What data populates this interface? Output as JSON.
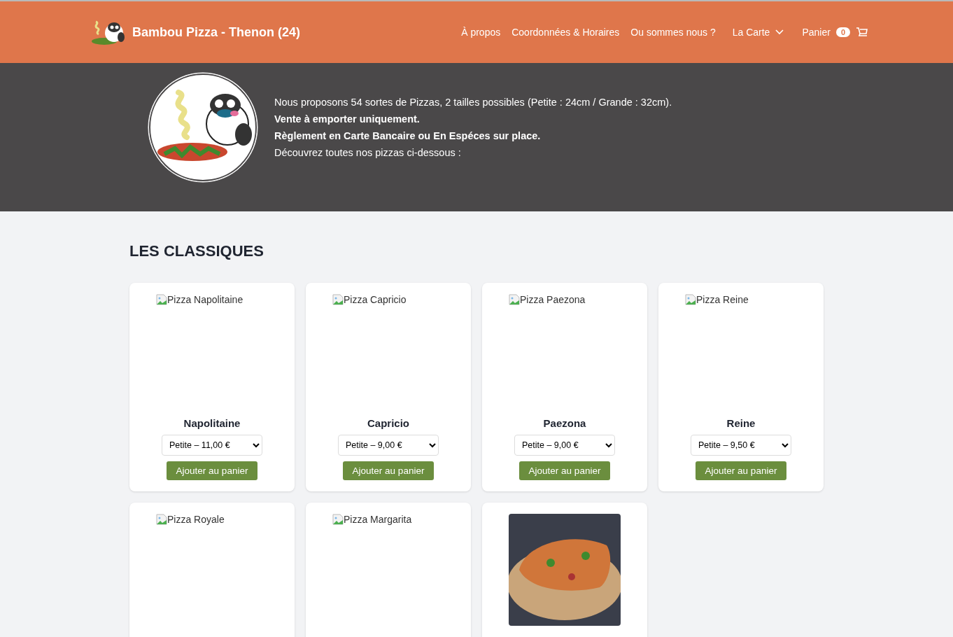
{
  "header": {
    "brand": "Bambou Pizza - Thenon (24)",
    "nav": [
      {
        "label": "À propos",
        "kind": "link"
      },
      {
        "label": "Coordonnées & Horaires",
        "kind": "link"
      },
      {
        "label": "Ou sommes nous ?",
        "kind": "link"
      },
      {
        "label": "La Carte",
        "kind": "dropdown"
      }
    ],
    "cart": {
      "label": "Panier",
      "count": "0"
    }
  },
  "hero": {
    "lines": [
      {
        "text": "Nous proposons 54 sortes de Pizzas, 2 tailles possibles (Petite : 24cm / Grande : 32cm).",
        "bold": false
      },
      {
        "text": "Vente à emporter uniquement.",
        "bold": true
      },
      {
        "text": "Règlement en Carte Bancaire ou En Espéces sur place.",
        "bold": true
      },
      {
        "text": "Découvrez toutes nos pizzas ci-dessous :",
        "bold": false
      }
    ]
  },
  "section": {
    "title": "LES CLASSIQUES",
    "products": [
      {
        "image": {
          "kind": "broken",
          "alt": "Pizza Napolitaine"
        },
        "name": "Napolitaine",
        "option": "Petite – 11,00 €",
        "button": "Ajouter au panier"
      },
      {
        "image": {
          "kind": "broken",
          "alt": "Pizza Capricio"
        },
        "name": "Capricio",
        "option": "Petite – 9,00 €",
        "button": "Ajouter au panier"
      },
      {
        "image": {
          "kind": "broken",
          "alt": "Pizza Paezona"
        },
        "name": "Paezona",
        "option": "Petite – 9,00 €",
        "button": "Ajouter au panier"
      },
      {
        "image": {
          "kind": "broken",
          "alt": "Pizza Reine"
        },
        "name": "Reine",
        "option": "Petite – 9,50 €",
        "button": "Ajouter au panier"
      },
      {
        "image": {
          "kind": "broken",
          "alt": "Pizza Royale"
        }
      },
      {
        "image": {
          "kind": "broken",
          "alt": "Pizza Margarita"
        }
      },
      {
        "image": {
          "kind": "photo"
        }
      }
    ]
  }
}
